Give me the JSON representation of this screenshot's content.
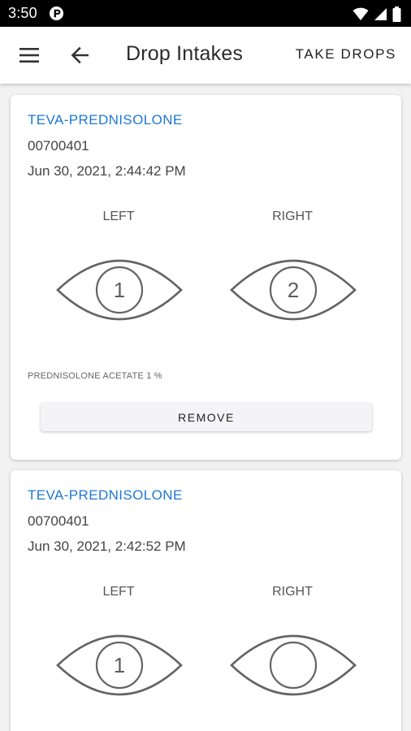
{
  "status_bar": {
    "time": "3:50"
  },
  "app_bar": {
    "title": "Drop Intakes",
    "action_label": "TAKE DROPS"
  },
  "intakes": [
    {
      "drug_name": "TEVA-PREDNISOLONE",
      "din": "00700401",
      "timestamp": "Jun 30, 2021, 2:44:42 PM",
      "left_label": "LEFT",
      "right_label": "RIGHT",
      "left_count": "1",
      "right_count": "2",
      "active_ingredient": "PREDNISOLONE ACETATE 1 %",
      "remove_label": "REMOVE"
    },
    {
      "drug_name": "TEVA-PREDNISOLONE",
      "din": "00700401",
      "timestamp": "Jun 30, 2021, 2:42:52 PM",
      "left_label": "LEFT",
      "right_label": "RIGHT",
      "left_count": "1",
      "right_count": ""
    }
  ],
  "colors": {
    "accent": "#1e78d6",
    "status_bar": "#000000"
  },
  "icons": {
    "menu": "menu-icon",
    "back": "arrow-left-icon",
    "eye": "eye-icon"
  }
}
